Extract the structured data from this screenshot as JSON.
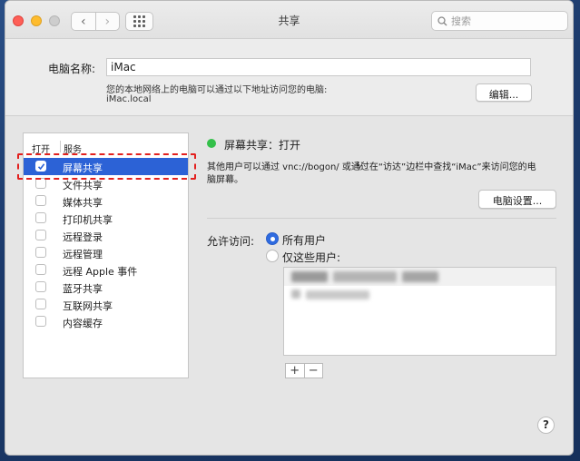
{
  "window": {
    "title": "共享",
    "search_placeholder": "搜索"
  },
  "computer_name": {
    "label": "电脑名称:",
    "value": "iMac",
    "description": "您的本地网络上的电脑可以通过以下地址访问您的电脑:",
    "address": "iMac.local",
    "edit_button": "编辑..."
  },
  "services": {
    "header_open": "打开",
    "header_service": "服务",
    "items": [
      {
        "label": "屏幕共享",
        "checked": true,
        "selected": true
      },
      {
        "label": "文件共享",
        "checked": false,
        "selected": false
      },
      {
        "label": "媒体共享",
        "checked": false,
        "selected": false
      },
      {
        "label": "打印机共享",
        "checked": false,
        "selected": false
      },
      {
        "label": "远程登录",
        "checked": false,
        "selected": false
      },
      {
        "label": "远程管理",
        "checked": false,
        "selected": false
      },
      {
        "label": "远程 Apple 事件",
        "checked": false,
        "selected": false
      },
      {
        "label": "蓝牙共享",
        "checked": false,
        "selected": false
      },
      {
        "label": "互联网共享",
        "checked": false,
        "selected": false
      },
      {
        "label": "内容缓存",
        "checked": false,
        "selected": false
      }
    ]
  },
  "detail": {
    "status": "屏幕共享：打开",
    "status_color": "#34c04a",
    "info_line1": "其他用户可以通过 vnc://bogon/ 或通过在“访达”边栏中查找“iMac”来访问您的电",
    "info_line2": "脑屏幕。",
    "settings_button": "电脑设置...",
    "allow_label": "允许访问:",
    "radio_all": "所有用户",
    "radio_only": "仅这些用户:",
    "add": "+",
    "remove": "−"
  },
  "help": "?",
  "colors": {
    "selection": "#2c62d6",
    "annotation": "#e3201e"
  }
}
